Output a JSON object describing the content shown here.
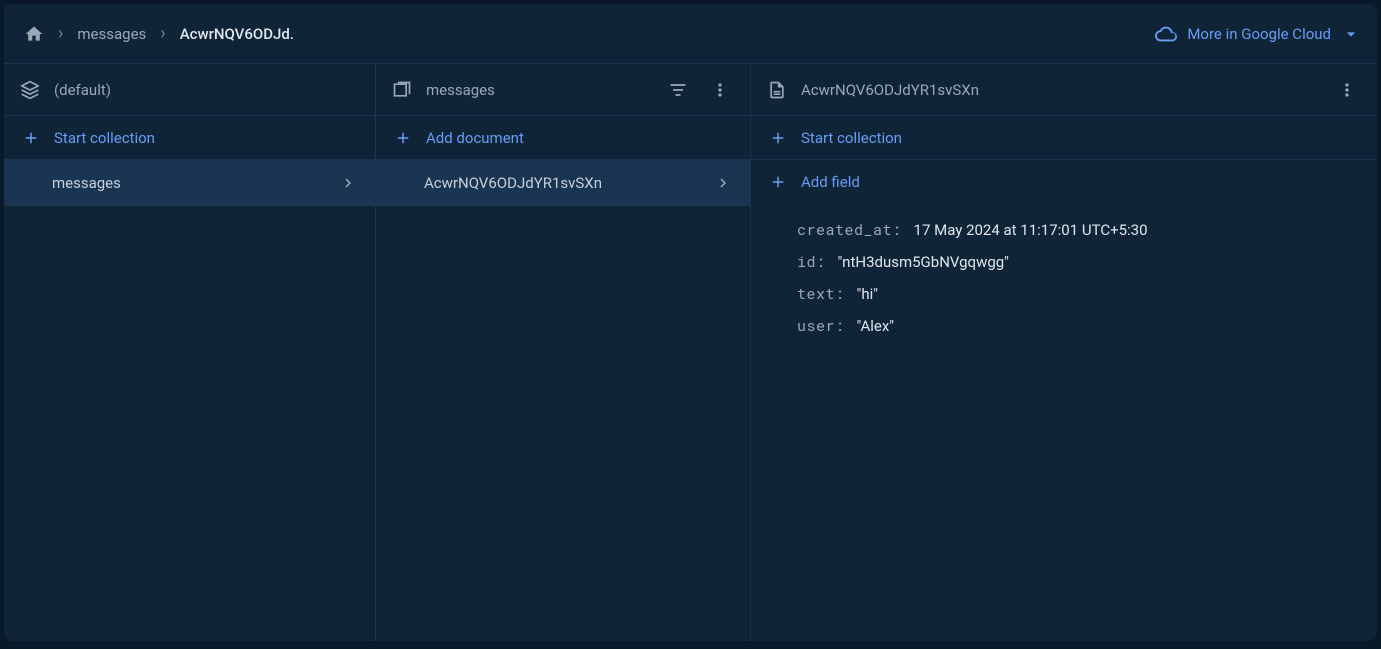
{
  "topbar": {
    "breadcrumb": {
      "item1": "messages",
      "item2": "AcwrNQV6ODJd."
    },
    "cloud_link": "More in Google Cloud"
  },
  "col1": {
    "header": "(default)",
    "start_collection": "Start collection",
    "items": [
      "messages"
    ]
  },
  "col2": {
    "header": "messages",
    "add_document": "Add document",
    "items": [
      "AcwrNQV6ODJdYR1svSXn"
    ]
  },
  "col3": {
    "header": "AcwrNQV6ODJdYR1svSXn",
    "start_collection": "Start collection",
    "add_field": "Add field",
    "fields": [
      {
        "key": "created_at:",
        "val": "17 May 2024 at 11:17:01 UTC+5:30"
      },
      {
        "key": "id:",
        "val": "\"ntH3dusm5GbNVgqwgg\""
      },
      {
        "key": "text:",
        "val": "\"hi\""
      },
      {
        "key": "user:",
        "val": "\"Alex\""
      }
    ]
  }
}
